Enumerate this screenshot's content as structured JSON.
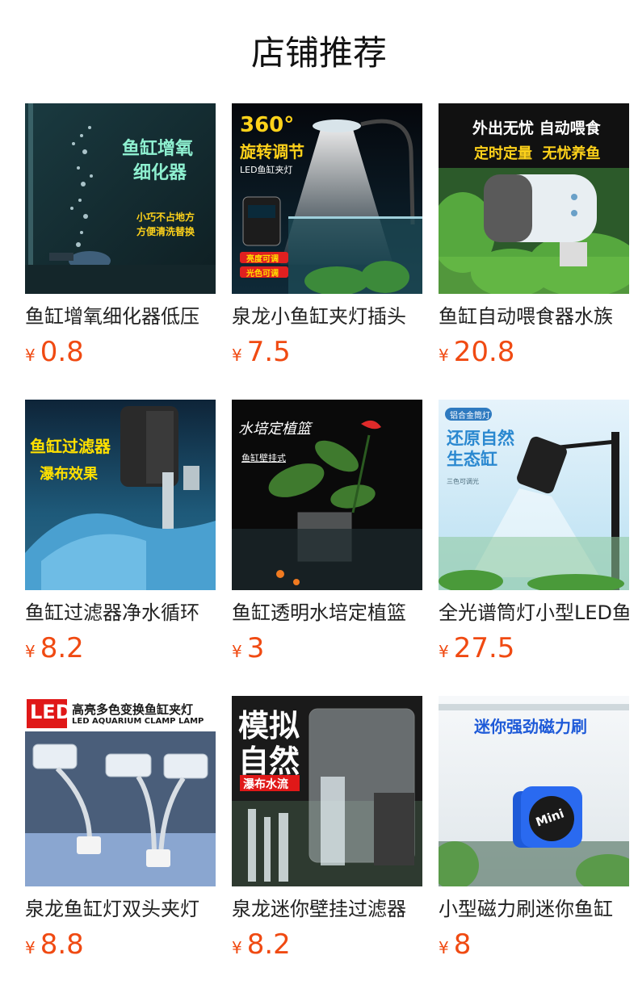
{
  "section": {
    "title": "店铺推荐"
  },
  "currency": "¥",
  "colors": {
    "price": "#f04a12",
    "title": "#111111",
    "text": "#222222"
  },
  "products": [
    {
      "title": "鱼缸增氧细化器低压",
      "price": "0.8",
      "image_text": [
        "鱼缸增氧",
        "细化器",
        "小巧不占地方",
        "方便清洗替换"
      ]
    },
    {
      "title": "泉龙小鱼缸夹灯插头",
      "price": "7.5",
      "image_text": [
        "360°",
        "旋转调节",
        "LED鱼缸夹灯",
        "亮度可调",
        "光色可调"
      ]
    },
    {
      "title": "鱼缸自动喂食器水族",
      "price": "20.8",
      "image_text": [
        "外出无忧 自动喂食",
        "定时定量  无忧养鱼"
      ]
    },
    {
      "title": "鱼缸过滤器净水循环",
      "price": "8.2",
      "image_text": [
        "鱼缸过滤器",
        "瀑布效果"
      ]
    },
    {
      "title": "鱼缸透明水培定植篮",
      "price": "3",
      "image_text": [
        "水培定植篮",
        "鱼缸壁挂式"
      ]
    },
    {
      "title": "全光谱筒灯小型LED鱼",
      "price": "27.5",
      "image_text": [
        "铝合金筒灯",
        "还原自然",
        "生态缸",
        "三色可调光"
      ]
    },
    {
      "title": "泉龙鱼缸灯双头夹灯",
      "price": "8.8",
      "image_text": [
        "LED",
        "高亮多色变换鱼缸夹灯",
        "LED AQUARIUM CLAMP LAMP"
      ]
    },
    {
      "title": "泉龙迷你壁挂过滤器",
      "price": "8.2",
      "image_text": [
        "模拟",
        "自然",
        "瀑布水流"
      ]
    },
    {
      "title": "小型磁力刷迷你鱼缸",
      "price": "8",
      "image_text": [
        "迷你强劲磁力刷",
        "Mini"
      ]
    }
  ]
}
